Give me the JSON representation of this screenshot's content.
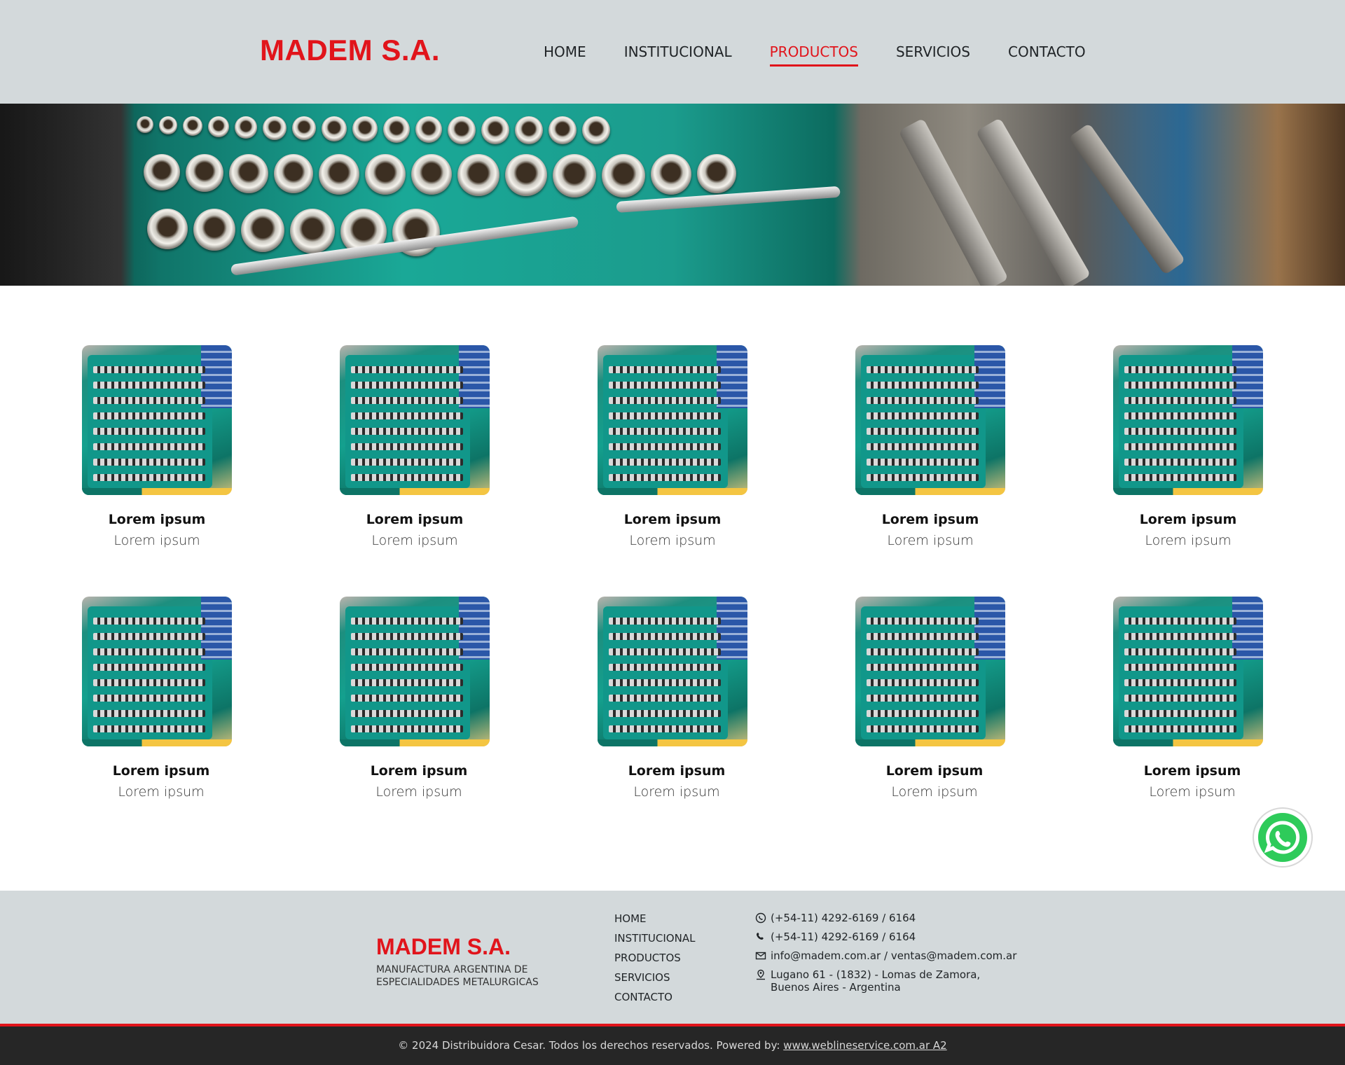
{
  "header": {
    "logo": "MADEM S.A.",
    "nav": [
      "HOME",
      "INSTITUCIONAL",
      "PRODUCTOS",
      "SERVICIOS",
      "CONTACTO"
    ],
    "active_nav": "PRODUCTOS"
  },
  "products": [
    {
      "title": "Lorem ipsum",
      "subtitle": "Lorem ipsum"
    },
    {
      "title": "Lorem ipsum",
      "subtitle": "Lorem ipsum"
    },
    {
      "title": "Lorem ipsum",
      "subtitle": "Lorem ipsum"
    },
    {
      "title": "Lorem ipsum",
      "subtitle": "Lorem ipsum"
    },
    {
      "title": "Lorem ipsum",
      "subtitle": "Lorem ipsum"
    },
    {
      "title": "Lorem ipsum",
      "subtitle": "Lorem ipsum"
    },
    {
      "title": "Lorem ipsum",
      "subtitle": "Lorem ipsum"
    },
    {
      "title": "Lorem ipsum",
      "subtitle": "Lorem ipsum"
    },
    {
      "title": "Lorem ipsum",
      "subtitle": "Lorem ipsum"
    },
    {
      "title": "Lorem ipsum",
      "subtitle": "Lorem ipsum"
    }
  ],
  "footer": {
    "logo": "MADEM S.A.",
    "tagline": "MANUFACTURA ARGENTINA DE ESPECIALIDADES METALURGICAS",
    "links": [
      "HOME",
      "INSTITUCIONAL",
      "PRODUCTOS",
      "SERVICIOS",
      "CONTACTO"
    ],
    "contacts": [
      {
        "icon": "whatsapp-icon",
        "text": "(+54-11) 4292-6169 / 6164"
      },
      {
        "icon": "phone-icon",
        "text": "(+54-11) 4292-6169 / 6164"
      },
      {
        "icon": "mail-icon",
        "text": "info@madem.com.ar / ventas@madem.com.ar"
      },
      {
        "icon": "location-icon",
        "text": "Lugano 61 - (1832) - Lomas de Zamora,",
        "text2": "Buenos Aires - Argentina"
      }
    ]
  },
  "copyright": {
    "text": "© 2024 Distribuidora Cesar. Todos los derechos reservados. Powered by:",
    "link": "www.weblineservice.com.ar A2"
  },
  "colors": {
    "accent": "#e1141b",
    "header_bg": "#d3d9db",
    "bottom_bar": "#262626",
    "whatsapp": "#2ecb5a"
  }
}
